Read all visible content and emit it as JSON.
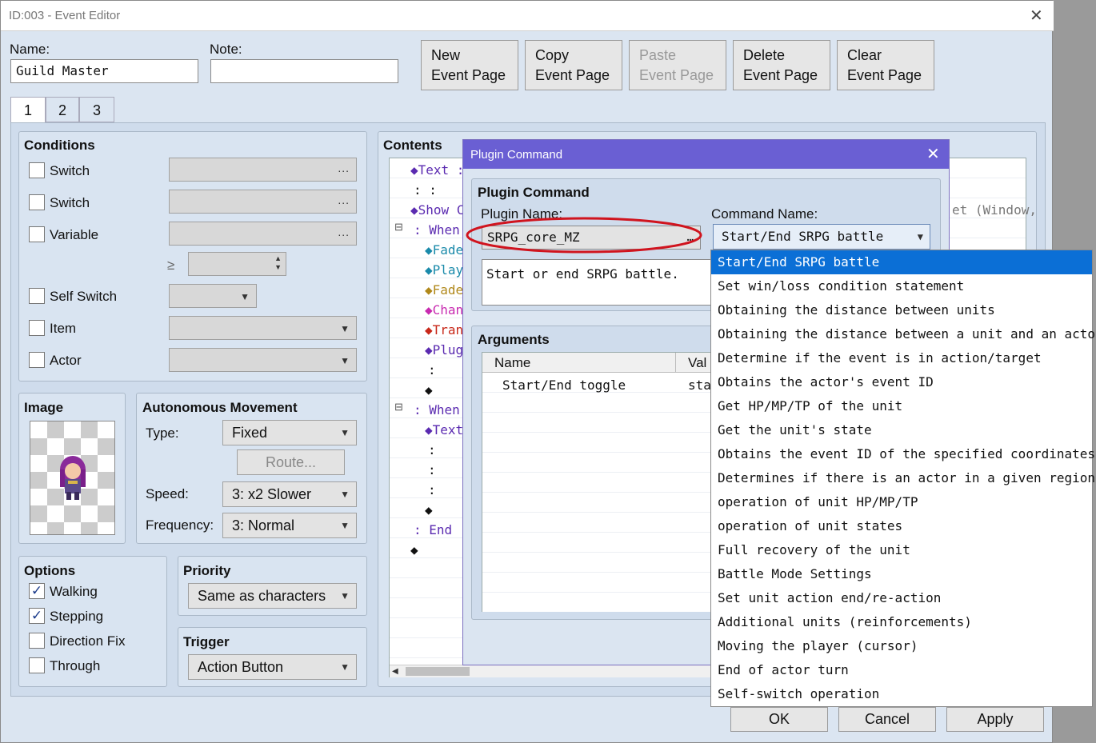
{
  "window": {
    "title": "ID:003 - Event Editor"
  },
  "name": {
    "label": "Name:",
    "value": "Guild Master"
  },
  "note": {
    "label": "Note:",
    "value": ""
  },
  "toolbar": {
    "new": [
      "New",
      "Event Page"
    ],
    "copy": [
      "Copy",
      "Event Page"
    ],
    "paste": [
      "Paste",
      "Event Page"
    ],
    "delete": [
      "Delete",
      "Event Page"
    ],
    "clear": [
      "Clear",
      "Event Page"
    ]
  },
  "tabs": [
    "1",
    "2",
    "3"
  ],
  "conditions": {
    "title": "Conditions",
    "switch1": "Switch",
    "switch2": "Switch",
    "variable": "Variable",
    "gte": "≥",
    "self_switch": "Self Switch",
    "item": "Item",
    "actor": "Actor",
    "dots": "..."
  },
  "image": {
    "title": "Image"
  },
  "autonomous": {
    "title": "Autonomous Movement",
    "type_label": "Type:",
    "type_value": "Fixed",
    "route": "Route...",
    "speed_label": "Speed:",
    "speed_value": "3: x2 Slower",
    "frequency_label": "Frequency:",
    "frequency_value": "3: Normal"
  },
  "options": {
    "title": "Options",
    "walking": "Walking",
    "stepping": "Stepping",
    "direction_fix": "Direction Fix",
    "through": "Through"
  },
  "priority": {
    "title": "Priority",
    "value": "Same as characters"
  },
  "trigger": {
    "title": "Trigger",
    "value": "Action Button"
  },
  "contents": {
    "title": "Contents",
    "l1": "◆Text :",
    "l2": ":      :",
    "l3": "◆Show C",
    "l4": ": When C",
    "l5": "◆Fade",
    "l6": "◆Play",
    "l7": "◆Fade",
    "l8": "◆Chan",
    "l9": "◆Tran",
    "l10": "◆Plug",
    "l11": ":",
    "l12": "◆",
    "l13": ": When W",
    "l14": "◆Text",
    "l15": ":",
    "l16": ":",
    "l17": ":",
    "l18": "◆",
    "l19": ": End",
    "l20": "◆",
    "partial_right": "et (Window,"
  },
  "dialog": {
    "title": "Plugin Command",
    "section": "Plugin Command",
    "plugin_name_label": "Plugin Name:",
    "plugin_name_value": "SRPG_core_MZ",
    "command_name_label": "Command Name:",
    "command_name_value": "Start/End SRPG battle",
    "description": "Start or end SRPG battle.",
    "arguments_title": "Arguments",
    "col_name": "Name",
    "col_value": "Val",
    "arg1_name": "Start/End toggle",
    "arg1_value": "sta"
  },
  "dropdown": [
    "Start/End SRPG battle",
    "Set win/loss condition statement",
    "Obtaining the distance between units",
    "Obtaining the distance between a unit and an actor",
    "Determine if the event is in action/target",
    "Obtains the actor's event ID",
    "Get HP/MP/TP of the unit",
    "Get the unit's state",
    "Obtains the event ID of the specified coordinates",
    "Determines if there is an actor in a given region",
    "operation of unit HP/MP/TP",
    "operation of unit states",
    "Full recovery of the unit",
    "Battle Mode Settings",
    "Set unit action end/re-action",
    "Additional units (reinforcements)",
    "Moving the player (cursor)",
    "End of actor turn",
    "Self-switch operation"
  ],
  "footer": {
    "ok": "OK",
    "cancel": "Cancel",
    "apply": "Apply"
  },
  "colors": {
    "accent": "#0b6fd6",
    "dialog_title": "#6a5fd3",
    "highlight_ellipse": "#d0141e",
    "command_purple": "#5a2ab0"
  }
}
